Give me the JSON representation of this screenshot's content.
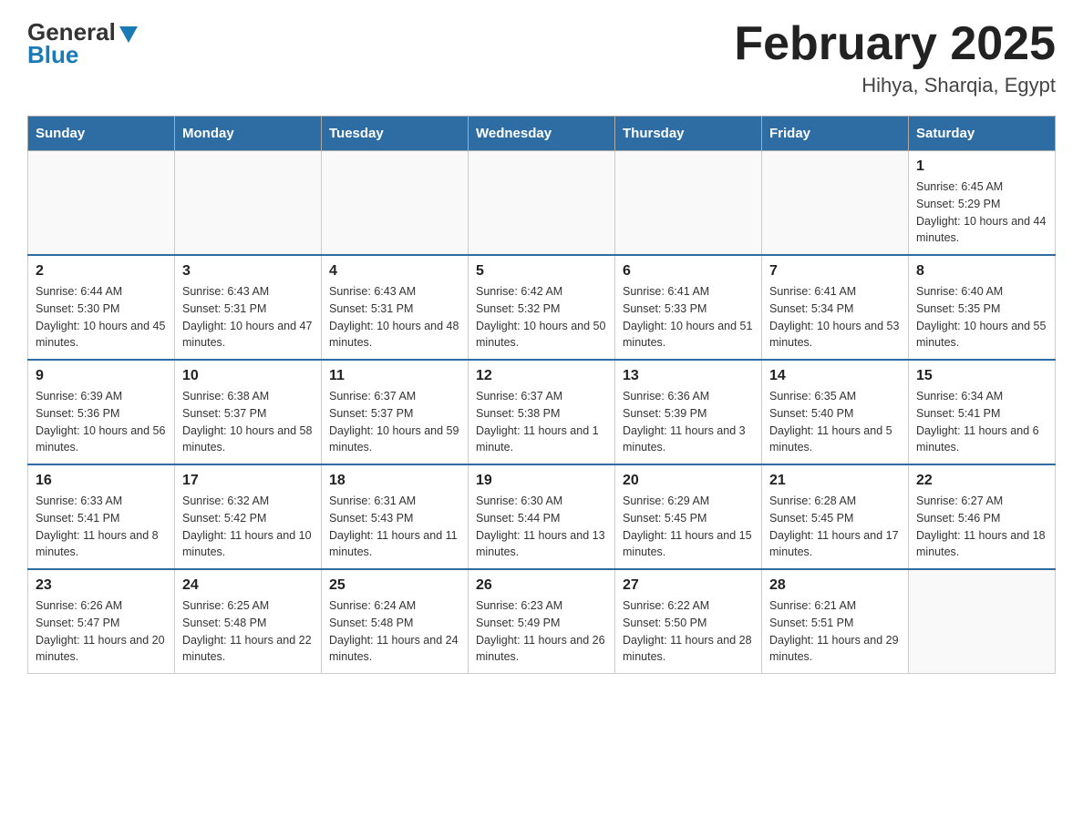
{
  "header": {
    "logo_general": "General",
    "logo_blue": "Blue",
    "title": "February 2025",
    "subtitle": "Hihya, Sharqia, Egypt"
  },
  "days_of_week": [
    "Sunday",
    "Monday",
    "Tuesday",
    "Wednesday",
    "Thursday",
    "Friday",
    "Saturday"
  ],
  "weeks": [
    [
      {
        "day": "",
        "sunrise": "",
        "sunset": "",
        "daylight": ""
      },
      {
        "day": "",
        "sunrise": "",
        "sunset": "",
        "daylight": ""
      },
      {
        "day": "",
        "sunrise": "",
        "sunset": "",
        "daylight": ""
      },
      {
        "day": "",
        "sunrise": "",
        "sunset": "",
        "daylight": ""
      },
      {
        "day": "",
        "sunrise": "",
        "sunset": "",
        "daylight": ""
      },
      {
        "day": "",
        "sunrise": "",
        "sunset": "",
        "daylight": ""
      },
      {
        "day": "1",
        "sunrise": "Sunrise: 6:45 AM",
        "sunset": "Sunset: 5:29 PM",
        "daylight": "Daylight: 10 hours and 44 minutes."
      }
    ],
    [
      {
        "day": "2",
        "sunrise": "Sunrise: 6:44 AM",
        "sunset": "Sunset: 5:30 PM",
        "daylight": "Daylight: 10 hours and 45 minutes."
      },
      {
        "day": "3",
        "sunrise": "Sunrise: 6:43 AM",
        "sunset": "Sunset: 5:31 PM",
        "daylight": "Daylight: 10 hours and 47 minutes."
      },
      {
        "day": "4",
        "sunrise": "Sunrise: 6:43 AM",
        "sunset": "Sunset: 5:31 PM",
        "daylight": "Daylight: 10 hours and 48 minutes."
      },
      {
        "day": "5",
        "sunrise": "Sunrise: 6:42 AM",
        "sunset": "Sunset: 5:32 PM",
        "daylight": "Daylight: 10 hours and 50 minutes."
      },
      {
        "day": "6",
        "sunrise": "Sunrise: 6:41 AM",
        "sunset": "Sunset: 5:33 PM",
        "daylight": "Daylight: 10 hours and 51 minutes."
      },
      {
        "day": "7",
        "sunrise": "Sunrise: 6:41 AM",
        "sunset": "Sunset: 5:34 PM",
        "daylight": "Daylight: 10 hours and 53 minutes."
      },
      {
        "day": "8",
        "sunrise": "Sunrise: 6:40 AM",
        "sunset": "Sunset: 5:35 PM",
        "daylight": "Daylight: 10 hours and 55 minutes."
      }
    ],
    [
      {
        "day": "9",
        "sunrise": "Sunrise: 6:39 AM",
        "sunset": "Sunset: 5:36 PM",
        "daylight": "Daylight: 10 hours and 56 minutes."
      },
      {
        "day": "10",
        "sunrise": "Sunrise: 6:38 AM",
        "sunset": "Sunset: 5:37 PM",
        "daylight": "Daylight: 10 hours and 58 minutes."
      },
      {
        "day": "11",
        "sunrise": "Sunrise: 6:37 AM",
        "sunset": "Sunset: 5:37 PM",
        "daylight": "Daylight: 10 hours and 59 minutes."
      },
      {
        "day": "12",
        "sunrise": "Sunrise: 6:37 AM",
        "sunset": "Sunset: 5:38 PM",
        "daylight": "Daylight: 11 hours and 1 minute."
      },
      {
        "day": "13",
        "sunrise": "Sunrise: 6:36 AM",
        "sunset": "Sunset: 5:39 PM",
        "daylight": "Daylight: 11 hours and 3 minutes."
      },
      {
        "day": "14",
        "sunrise": "Sunrise: 6:35 AM",
        "sunset": "Sunset: 5:40 PM",
        "daylight": "Daylight: 11 hours and 5 minutes."
      },
      {
        "day": "15",
        "sunrise": "Sunrise: 6:34 AM",
        "sunset": "Sunset: 5:41 PM",
        "daylight": "Daylight: 11 hours and 6 minutes."
      }
    ],
    [
      {
        "day": "16",
        "sunrise": "Sunrise: 6:33 AM",
        "sunset": "Sunset: 5:41 PM",
        "daylight": "Daylight: 11 hours and 8 minutes."
      },
      {
        "day": "17",
        "sunrise": "Sunrise: 6:32 AM",
        "sunset": "Sunset: 5:42 PM",
        "daylight": "Daylight: 11 hours and 10 minutes."
      },
      {
        "day": "18",
        "sunrise": "Sunrise: 6:31 AM",
        "sunset": "Sunset: 5:43 PM",
        "daylight": "Daylight: 11 hours and 11 minutes."
      },
      {
        "day": "19",
        "sunrise": "Sunrise: 6:30 AM",
        "sunset": "Sunset: 5:44 PM",
        "daylight": "Daylight: 11 hours and 13 minutes."
      },
      {
        "day": "20",
        "sunrise": "Sunrise: 6:29 AM",
        "sunset": "Sunset: 5:45 PM",
        "daylight": "Daylight: 11 hours and 15 minutes."
      },
      {
        "day": "21",
        "sunrise": "Sunrise: 6:28 AM",
        "sunset": "Sunset: 5:45 PM",
        "daylight": "Daylight: 11 hours and 17 minutes."
      },
      {
        "day": "22",
        "sunrise": "Sunrise: 6:27 AM",
        "sunset": "Sunset: 5:46 PM",
        "daylight": "Daylight: 11 hours and 18 minutes."
      }
    ],
    [
      {
        "day": "23",
        "sunrise": "Sunrise: 6:26 AM",
        "sunset": "Sunset: 5:47 PM",
        "daylight": "Daylight: 11 hours and 20 minutes."
      },
      {
        "day": "24",
        "sunrise": "Sunrise: 6:25 AM",
        "sunset": "Sunset: 5:48 PM",
        "daylight": "Daylight: 11 hours and 22 minutes."
      },
      {
        "day": "25",
        "sunrise": "Sunrise: 6:24 AM",
        "sunset": "Sunset: 5:48 PM",
        "daylight": "Daylight: 11 hours and 24 minutes."
      },
      {
        "day": "26",
        "sunrise": "Sunrise: 6:23 AM",
        "sunset": "Sunset: 5:49 PM",
        "daylight": "Daylight: 11 hours and 26 minutes."
      },
      {
        "day": "27",
        "sunrise": "Sunrise: 6:22 AM",
        "sunset": "Sunset: 5:50 PM",
        "daylight": "Daylight: 11 hours and 28 minutes."
      },
      {
        "day": "28",
        "sunrise": "Sunrise: 6:21 AM",
        "sunset": "Sunset: 5:51 PM",
        "daylight": "Daylight: 11 hours and 29 minutes."
      },
      {
        "day": "",
        "sunrise": "",
        "sunset": "",
        "daylight": ""
      }
    ]
  ]
}
